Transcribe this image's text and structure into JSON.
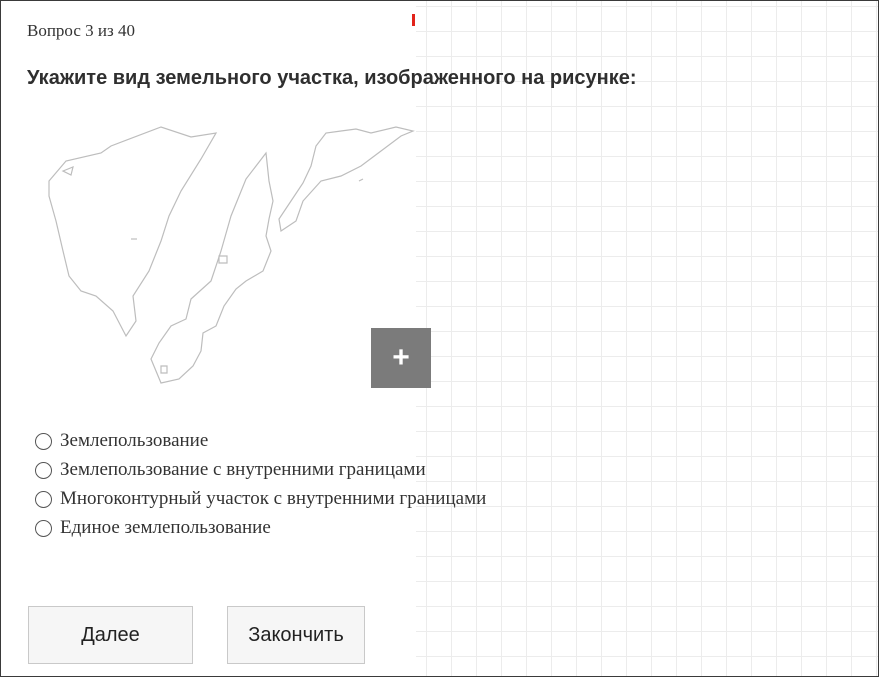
{
  "quiz": {
    "counter": "Вопрос 3 из 40",
    "question": "Укажите вид земельного участка, изображенного на рисунке:",
    "zoom_label": "+",
    "options": [
      {
        "label": "Землепользование"
      },
      {
        "label": "Землепользование с внутренними границами"
      },
      {
        "label": "Многоконтурный участок с внутренними границами"
      },
      {
        "label": "Единое землепользование"
      }
    ],
    "buttons": {
      "next_label": "Далее",
      "finish_label": "Закончить"
    }
  },
  "colors": {
    "accent_mark": "#e2231a",
    "zoom_button": "#7b7b7b",
    "grid_line": "#ececec"
  }
}
